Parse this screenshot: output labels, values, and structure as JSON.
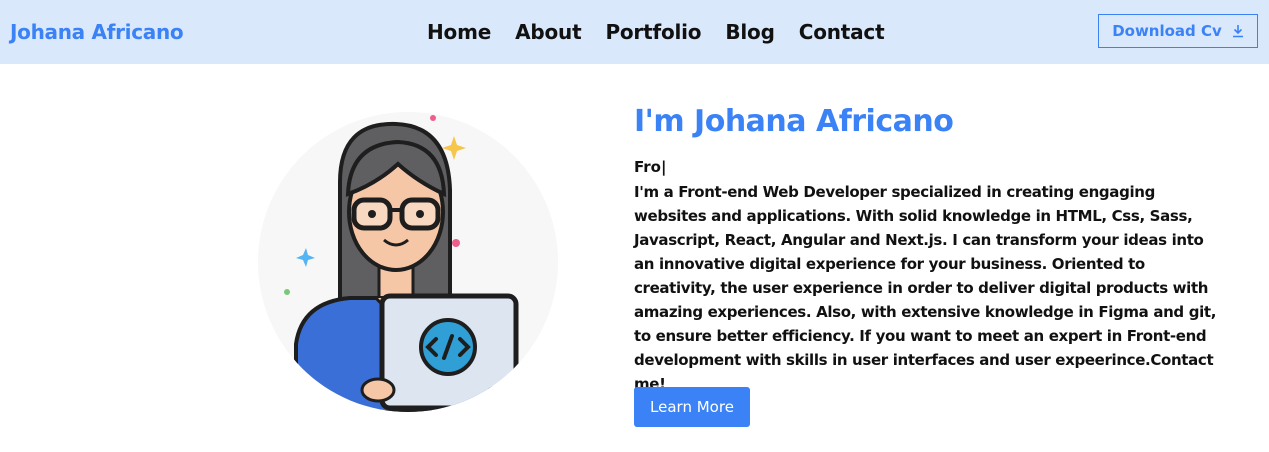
{
  "navbar": {
    "brand": "Johana Africano",
    "links": [
      {
        "label": "Home"
      },
      {
        "label": "About"
      },
      {
        "label": "Portfolio"
      },
      {
        "label": "Blog"
      },
      {
        "label": "Contact"
      }
    ],
    "download_label": "Download Cv",
    "download_icon": "download-icon"
  },
  "hero": {
    "title": "I'm Johana Africano",
    "typing_text": "Fro|",
    "bio": "I'm a Front-end Web Developer specialized in creating engaging websites and applications. With solid knowledge in HTML, Css, Sass, Javascript, React, Angular and Next.js. I can transform your ideas into an innovative digital experience for your business. Oriented to creativity, the user experience in order to deliver digital products with amazing experiences. Also, with extensive knowledge in Figma and git, to ensure better efficiency. If you want to meet an expert in Front-end development with skills in user interfaces and user expeerince.Contact me!",
    "cta_label": "Learn More"
  },
  "colors": {
    "accent": "#3b82f6",
    "navbar_bg": "#d9e8fb"
  }
}
